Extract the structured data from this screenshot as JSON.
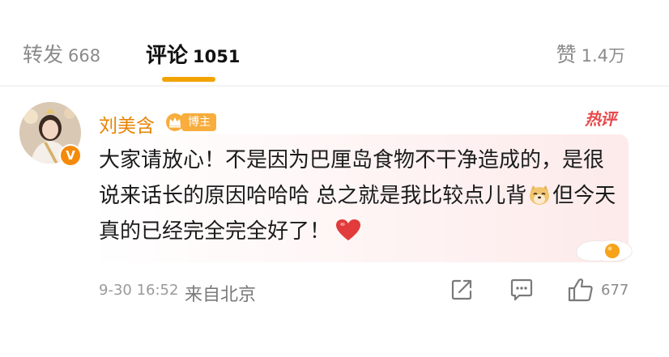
{
  "tabs": {
    "repost": {
      "label": "转发",
      "count": "668"
    },
    "comments": {
      "label": "评论",
      "count": "1051"
    },
    "likes": {
      "label": "赞",
      "count": "1.4万"
    }
  },
  "comment": {
    "username": "刘美含",
    "badge": "博主",
    "hot_label": "热评",
    "verified_mark": "V",
    "text_part1": "大家请放心！不是因为巴厘岛食物不干净造成的，是很说来话长的原因哈哈哈 总之就是我比较点儿背",
    "text_part2": "但今天真的已经完全完全好了！",
    "time": "9-30 16:52",
    "location": "来自北京",
    "like_count": "677"
  },
  "colors": {
    "accent": "#f2a300",
    "username": "#e88200",
    "hot": "#e8494b",
    "heart": "#e23b3b"
  },
  "icons": [
    "crown-icon",
    "doge-emoji-icon",
    "heart-emoji-icon",
    "egg-icon",
    "share-icon",
    "reply-icon",
    "like-icon"
  ]
}
